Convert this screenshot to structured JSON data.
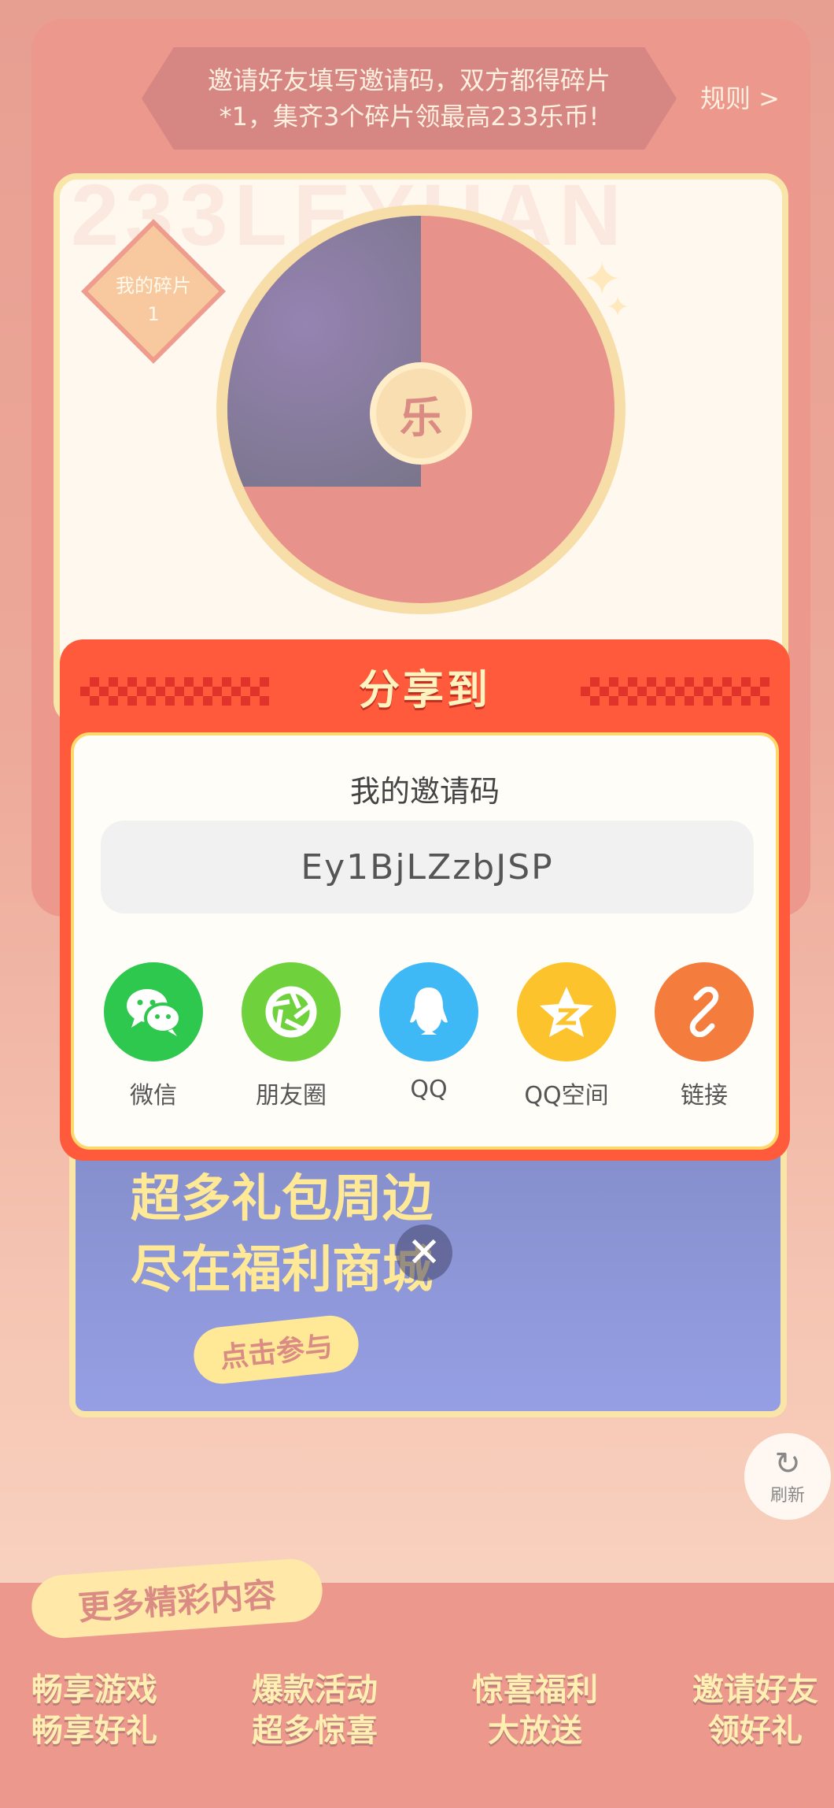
{
  "background": {
    "rule_banner": "邀请好友填写邀请码，双方都得碎片*1，集齐3个碎片领最高233乐币!",
    "rule_link": "规则 >",
    "pieces_label": "我的碎片",
    "pieces_count": "1",
    "wheel_center": "乐",
    "bg_letters": "233LEYUAN",
    "banner_title_line1": "超多礼包周边",
    "banner_title_line2": "尽在福利商城",
    "banner_button": "点击参与",
    "refresh_label": "刷新",
    "more_tag": "更多精彩内容",
    "bottom_tiles": [
      {
        "line1": "畅享游戏",
        "line2": "畅享好礼"
      },
      {
        "line1": "爆款活动",
        "line2": "超多惊喜"
      },
      {
        "line1": "惊喜福利",
        "line2": "大放送"
      },
      {
        "line1": "邀请好友",
        "line2": "领好礼"
      }
    ]
  },
  "dialog": {
    "title": "分享到",
    "code_label": "我的邀请码",
    "code_value": "Ey1BjLZzbJSP",
    "share_targets": [
      {
        "label": "微信",
        "icon": "wechat-icon",
        "color": "#2dc84d"
      },
      {
        "label": "朋友圈",
        "icon": "moments-icon",
        "color": "#6fd23c"
      },
      {
        "label": "QQ",
        "icon": "qq-icon",
        "color": "#3fb8f6"
      },
      {
        "label": "QQ空间",
        "icon": "qzone-icon",
        "color": "#fcc32c"
      },
      {
        "label": "链接",
        "icon": "link-icon",
        "color": "#f47c3c"
      }
    ],
    "close_glyph": "✕"
  },
  "colors": {
    "dialog_red": "#ff5a3c",
    "accent_gold": "#ffd86a"
  }
}
